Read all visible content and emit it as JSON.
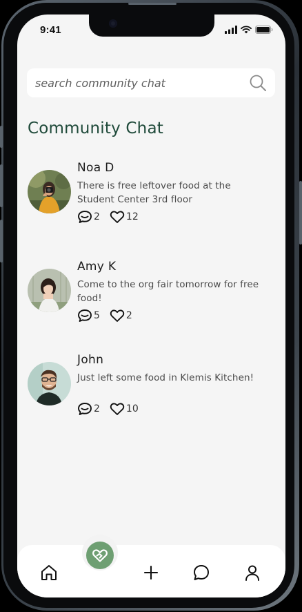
{
  "status_bar": {
    "time": "9:41"
  },
  "search": {
    "placeholder": "search community chat",
    "icon": "search-icon"
  },
  "page_title": "Community Chat",
  "posts": [
    {
      "name": "Noa D",
      "text": "There is free leftover food at the Student Center 3rd floor",
      "comments": "2",
      "likes": "12",
      "avatar": "avatar-noa"
    },
    {
      "name": "Amy K",
      "text": "Come to the org fair tomorrow for free food!",
      "comments": "5",
      "likes": "2",
      "avatar": "avatar-amy"
    },
    {
      "name": "John",
      "text": "Just left some food in Klemis Kitchen!",
      "comments": "2",
      "likes": "10",
      "avatar": "avatar-john"
    }
  ],
  "bottom_nav": {
    "items": [
      "home-icon",
      "heart-hands-icon",
      "plus-icon",
      "chat-icon",
      "profile-icon"
    ]
  },
  "colors": {
    "title": "#1f4a3a",
    "accent_green": "#6e9f72",
    "screen_bg": "#f5f5f5"
  }
}
